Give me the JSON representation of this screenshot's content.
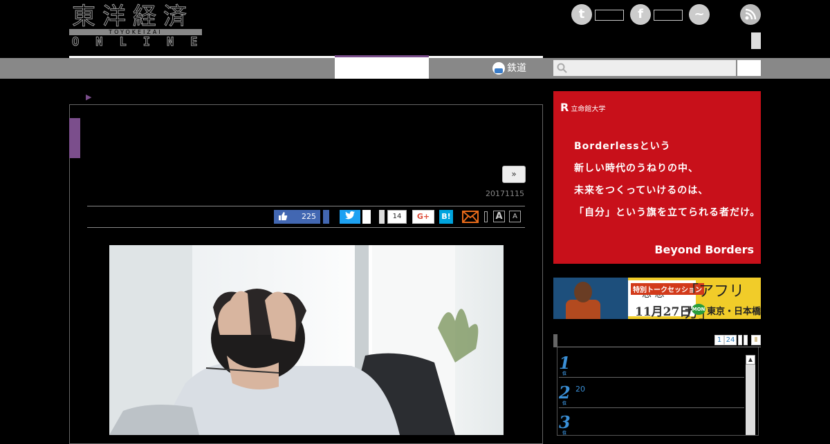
{
  "header": {
    "logo_kanji": "東洋経済",
    "logo_romaji": "TOYOKEIZAI",
    "logo_online": "ONLINE",
    "social": [
      {
        "name": "twitter",
        "color": "#cccccc"
      },
      {
        "name": "facebook",
        "color": "#cccccc"
      },
      {
        "name": "messenger",
        "color": "#cccccc"
      }
    ],
    "twitter_glyph": "t",
    "facebook_glyph": "f",
    "messenger_glyph": "~"
  },
  "nav": {
    "rail_label": "鉄道",
    "search_placeholder": "",
    "accent_color": "#7b4e8c"
  },
  "article": {
    "next_label": "»",
    "date": "20171115",
    "share": {
      "like_count": "225",
      "hatena_count": "14",
      "gplus_label": "G+",
      "hatena_label": "B!",
      "font_large": "A",
      "font_small": "A"
    }
  },
  "sidebar": {
    "ad1": {
      "brand": "立命館大学",
      "brand_mark": "R",
      "copy_lines": [
        "Borderlessという",
        "新しい時代のうねりの中、",
        "未来をつくっていけるのは、",
        "「自分」という旗を立てられる者だけ。"
      ],
      "tagline": "Beyond Borders",
      "color": "#c8101a"
    },
    "ad2": {
      "magazine": "思 想",
      "event_label": "特別トークセッション",
      "title": "「アフリカ」",
      "date": "11月27日",
      "day": "MON",
      "place": "東京・日本橋",
      "color": "#f1cc29"
    },
    "ranking": {
      "tabs": [
        "1",
        "24"
      ],
      "items": [
        {
          "rank": "1",
          "suffix": "位",
          "text": ""
        },
        {
          "rank": "2",
          "suffix": "位",
          "text": "20"
        },
        {
          "rank": "3",
          "suffix": "位",
          "text": ""
        }
      ]
    }
  }
}
